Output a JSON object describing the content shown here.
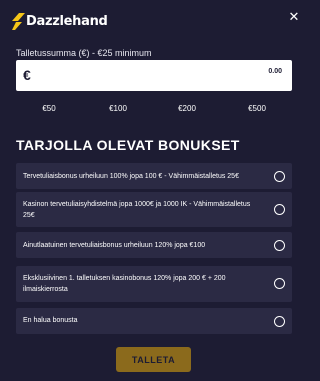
{
  "header": {
    "logo_text": "Dazzlehand",
    "brand_color": "#f5c518",
    "close_icon": "close-icon"
  },
  "deposit": {
    "label": "Talletussumma (€) - €25 minimum",
    "currency_symbol": "€",
    "amount_value": "0.00",
    "presets": [
      "€50",
      "€100",
      "€200",
      "€500"
    ]
  },
  "bonuses": {
    "title": "TARJOLLA OLEVAT BONUKSET",
    "options": [
      {
        "label": "Tervetuliaisbonus urheiluun 100% jopa 100 € - Vähimmäistalletus 25€",
        "selected": false
      },
      {
        "label": "Kasinon tervetuliaisyhdistelmä jopa 1000€ ja 1000 IK - Vähimmäistalletus 25€",
        "selected": false
      },
      {
        "label": "Ainutlaatuinen tervetuliaisbonus urheiluun 120% jopa €100",
        "selected": false
      },
      {
        "label": "Eksklusiivinen 1. talletuksen kasinobonus 120% jopa 200 € + 200 ilmaiskierrosta",
        "selected": false
      },
      {
        "label": "En halua bonusta",
        "selected": false
      }
    ]
  },
  "submit": {
    "label": "TALLETA",
    "color": "#8b6a1c"
  }
}
